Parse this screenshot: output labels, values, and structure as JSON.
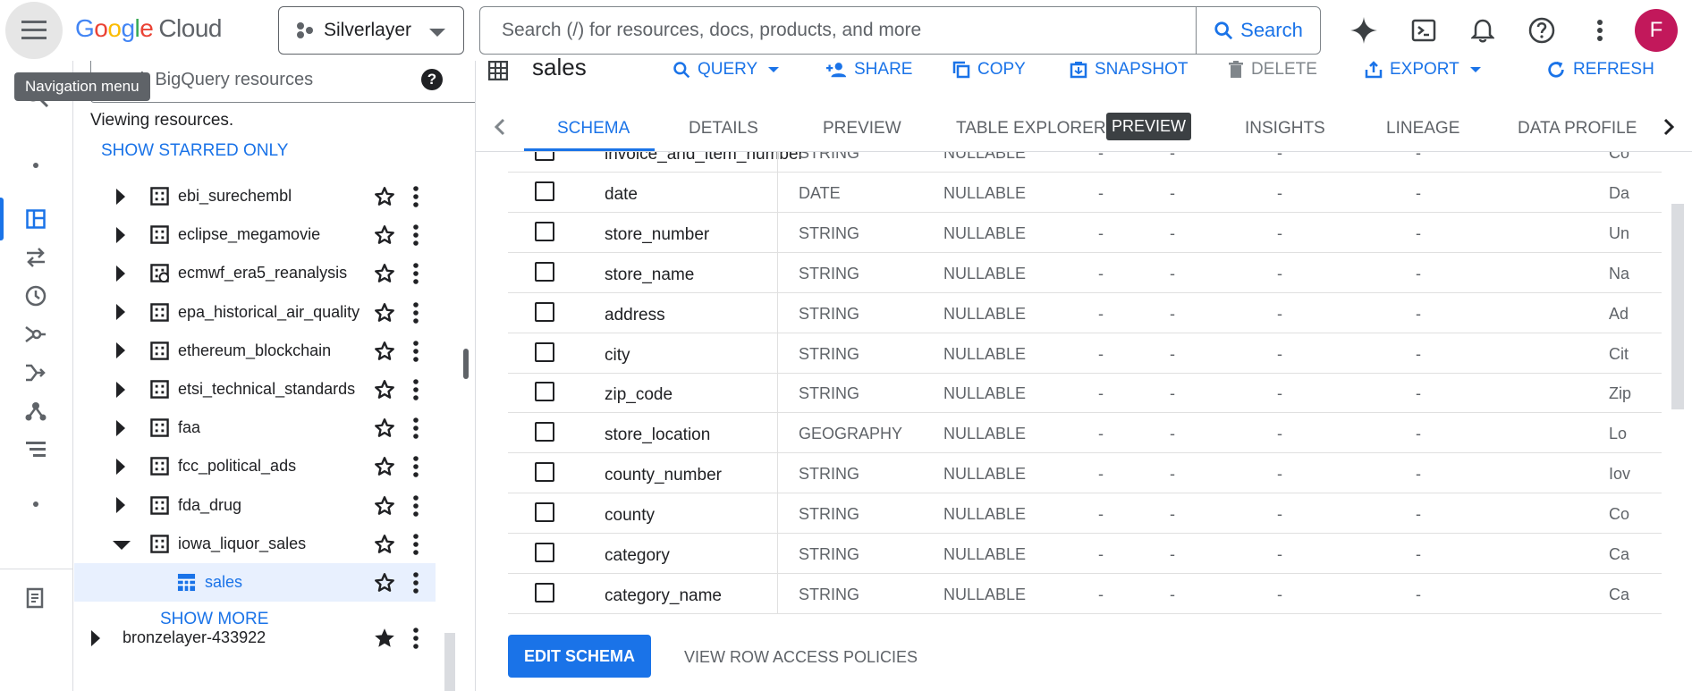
{
  "header": {
    "menu_tooltip": "Navigation menu",
    "logo_letters": [
      "G",
      "o",
      "o",
      "g",
      "l",
      "e"
    ],
    "logo_suffix": "Cloud",
    "project_name": "Silverlayer",
    "search_placeholder": "Search (/) for resources, docs, products, and more",
    "search_button": "Search",
    "avatar_letter": "F"
  },
  "explorer": {
    "search_placeholder": "rch BigQuery resources",
    "viewing_text": "Viewing resources.",
    "starred_link": "SHOW STARRED ONLY",
    "datasets": [
      {
        "label": "ebi_surechembl",
        "type": "dataset",
        "expanded": false,
        "starred": false
      },
      {
        "label": "eclipse_megamovie",
        "type": "dataset",
        "expanded": false,
        "starred": false
      },
      {
        "label": "ecmwf_era5_reanalysis",
        "type": "linked-dataset",
        "expanded": false,
        "starred": false
      },
      {
        "label": "epa_historical_air_quality",
        "type": "dataset",
        "expanded": false,
        "starred": false
      },
      {
        "label": "ethereum_blockchain",
        "type": "dataset",
        "expanded": false,
        "starred": false
      },
      {
        "label": "etsi_technical_standards",
        "type": "dataset",
        "expanded": false,
        "starred": false
      },
      {
        "label": "faa",
        "type": "dataset",
        "expanded": false,
        "starred": false
      },
      {
        "label": "fcc_political_ads",
        "type": "dataset",
        "expanded": false,
        "starred": false
      },
      {
        "label": "fda_drug",
        "type": "dataset",
        "expanded": false,
        "starred": false
      },
      {
        "label": "iowa_liquor_sales",
        "type": "dataset",
        "expanded": true,
        "starred": false
      }
    ],
    "selected_table": {
      "label": "sales",
      "starred": false
    },
    "show_more": "SHOW MORE",
    "project": {
      "label": "bronzelayer-433922",
      "starred": true
    }
  },
  "main": {
    "table_name": "sales",
    "actions": [
      {
        "label": "QUERY",
        "icon": "search-icon",
        "dropdown": true,
        "disabled": false
      },
      {
        "label": "SHARE",
        "icon": "person-add-icon",
        "dropdown": false,
        "disabled": false
      },
      {
        "label": "COPY",
        "icon": "copy-icon",
        "dropdown": false,
        "disabled": false
      },
      {
        "label": "SNAPSHOT",
        "icon": "snapshot-icon",
        "dropdown": false,
        "disabled": false
      },
      {
        "label": "DELETE",
        "icon": "trash-icon",
        "dropdown": false,
        "disabled": true
      },
      {
        "label": "EXPORT",
        "icon": "export-icon",
        "dropdown": true,
        "disabled": false
      },
      {
        "label": "REFRESH",
        "icon": "refresh-icon",
        "dropdown": false,
        "disabled": false
      }
    ],
    "tabs": [
      "SCHEMA",
      "DETAILS",
      "PREVIEW",
      "TABLE EXPLORER",
      "INSIGHTS",
      "LINEAGE",
      "DATA PROFILE"
    ],
    "active_tab": "SCHEMA",
    "preview_badge": "PREVIEW",
    "schema_rows": [
      {
        "name": "invoice_and_item_number",
        "type": "STRING",
        "mode": "NULLABLE",
        "desc": "Co"
      },
      {
        "name": "date",
        "type": "DATE",
        "mode": "NULLABLE",
        "desc": "Da"
      },
      {
        "name": "store_number",
        "type": "STRING",
        "mode": "NULLABLE",
        "desc": "Un"
      },
      {
        "name": "store_name",
        "type": "STRING",
        "mode": "NULLABLE",
        "desc": "Na"
      },
      {
        "name": "address",
        "type": "STRING",
        "mode": "NULLABLE",
        "desc": "Ad"
      },
      {
        "name": "city",
        "type": "STRING",
        "mode": "NULLABLE",
        "desc": "Cit"
      },
      {
        "name": "zip_code",
        "type": "STRING",
        "mode": "NULLABLE",
        "desc": "Zip"
      },
      {
        "name": "store_location",
        "type": "GEOGRAPHY",
        "mode": "NULLABLE",
        "desc": "Lo"
      },
      {
        "name": "county_number",
        "type": "STRING",
        "mode": "NULLABLE",
        "desc": "Iov"
      },
      {
        "name": "county",
        "type": "STRING",
        "mode": "NULLABLE",
        "desc": "Co"
      },
      {
        "name": "category",
        "type": "STRING",
        "mode": "NULLABLE",
        "desc": "Ca"
      },
      {
        "name": "category_name",
        "type": "STRING",
        "mode": "NULLABLE",
        "desc": "Ca"
      }
    ],
    "dash": "-",
    "edit_schema_button": "EDIT SCHEMA",
    "row_access_link": "VIEW ROW ACCESS POLICIES"
  },
  "colors": {
    "accent": "#1a73e8",
    "avatar": "#c2185b",
    "selected_row": "#e8f0fe"
  }
}
